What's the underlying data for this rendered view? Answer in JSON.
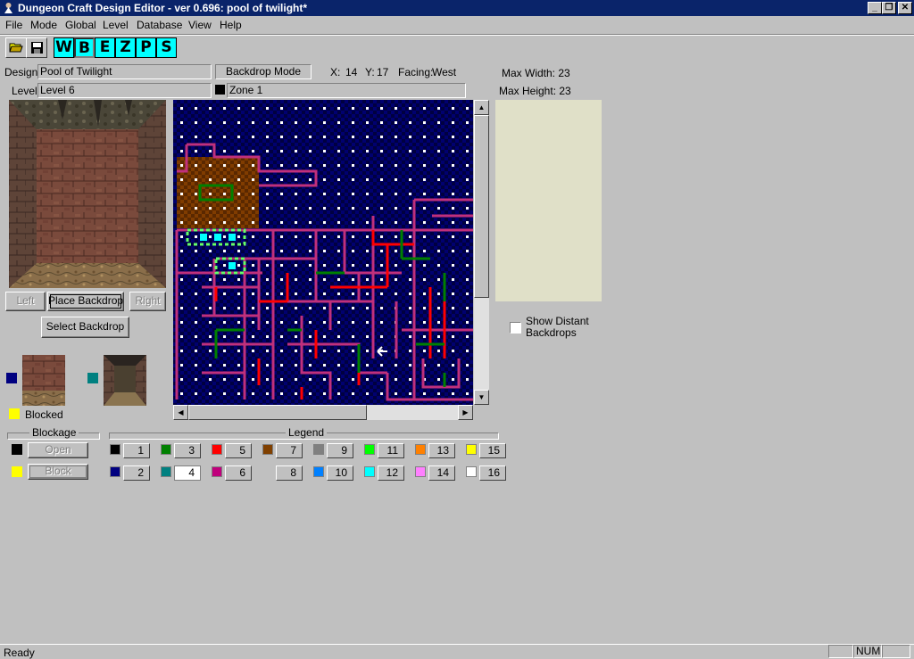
{
  "window": {
    "title": "Dungeon Craft Design Editor - ver 0.696: pool of twilight*",
    "minimize": "_",
    "restore": "❐",
    "close": "✕"
  },
  "menu": [
    {
      "label": "File"
    },
    {
      "label": "Mode"
    },
    {
      "label": "Global"
    },
    {
      "label": "Level"
    },
    {
      "label": "Database"
    },
    {
      "label": "View"
    },
    {
      "label": "Help"
    }
  ],
  "toolbar": {
    "open_icon": "folder-open-icon",
    "save_icon": "floppy-disk-icon",
    "modes": [
      "W",
      "B",
      "E",
      "Z",
      "P",
      "S"
    ],
    "active_mode": "B"
  },
  "info": {
    "design_label": "Design",
    "design_value": "Pool of Twilight",
    "mode_value": "Backdrop Mode",
    "x_label": "X:",
    "x_value": "14",
    "y_label": "Y:",
    "y_value": "17",
    "facing_label": "Facing:",
    "facing_value": "West",
    "level_label": "Level",
    "level_value": "Level 6",
    "zone_value": "Zone 1",
    "max_width": "Max Width: 23",
    "max_height": "Max Height: 23"
  },
  "preview": {
    "left_button": "Left",
    "place_button": "Place Backdrop",
    "right_button": "Right",
    "select_button": "Select Backdrop",
    "blocked_label": "Blocked",
    "show_distant_label": "Show Distant Backdrops",
    "show_distant_checked": false
  },
  "blockage": {
    "title": "Blockage",
    "open_button": "Open",
    "block_button": "Block"
  },
  "legend": {
    "title": "Legend",
    "selected": "4",
    "entries": [
      {
        "num": "1",
        "color": "#000000"
      },
      {
        "num": "2",
        "color": "#000080"
      },
      {
        "num": "3",
        "color": "#008000"
      },
      {
        "num": "4",
        "color": "#008080"
      },
      {
        "num": "5",
        "color": "#ff0000"
      },
      {
        "num": "6",
        "color": "#c0007c"
      },
      {
        "num": "7",
        "color": "#804000"
      },
      {
        "num": "8",
        "color": "#c0c0c0"
      },
      {
        "num": "9",
        "color": "#808080"
      },
      {
        "num": "10",
        "color": "#0080ff"
      },
      {
        "num": "11",
        "color": "#00ff00"
      },
      {
        "num": "12",
        "color": "#00ffff"
      },
      {
        "num": "13",
        "color": "#ff8000"
      },
      {
        "num": "14",
        "color": "#ff80ff"
      },
      {
        "num": "15",
        "color": "#ffff00"
      },
      {
        "num": "16",
        "color": "#ffffff"
      }
    ]
  },
  "colors": {
    "title_bar": "#0a246a",
    "map_bg": "#000033",
    "map_dot": "#ffffff",
    "wall_magenta": "#c0307c",
    "wall_red": "#ff0000",
    "wall_green": "#008000",
    "zone_swatch": "#000000",
    "preview_swatch_1": "#000080",
    "preview_swatch_2": "#008080",
    "blocked_swatch": "#ffff00",
    "minimap_bg": "#e0e0c8"
  },
  "status": {
    "text": "Ready",
    "num": "NUM"
  }
}
